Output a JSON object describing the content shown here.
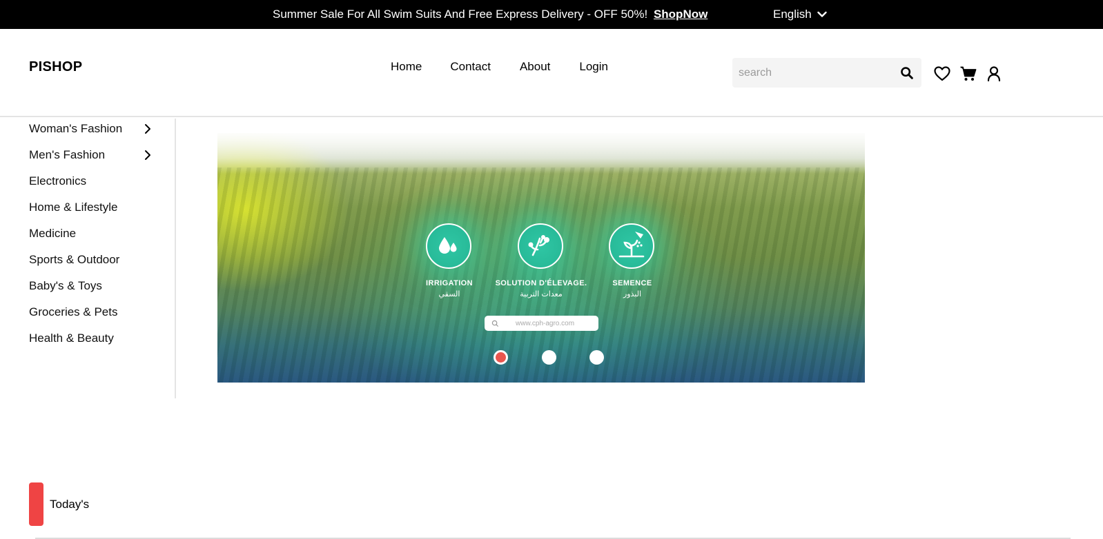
{
  "topbar": {
    "promo_text": "Summer Sale For All Swim Suits And Free Express Delivery - OFF 50%!",
    "promo_link": "ShopNow",
    "language": "English"
  },
  "header": {
    "logo": "PISHOP",
    "nav": [
      "Home",
      "Contact",
      "About",
      "Login"
    ],
    "search_placeholder": "search",
    "icons": [
      "search-icon",
      "heart-icon",
      "cart-icon",
      "user-icon"
    ]
  },
  "sidebar": {
    "items": [
      {
        "label": "Woman's Fashion",
        "has_submenu": true
      },
      {
        "label": "Men's Fashion",
        "has_submenu": true
      },
      {
        "label": "Electronics",
        "has_submenu": false
      },
      {
        "label": "Home & Lifestyle",
        "has_submenu": false
      },
      {
        "label": "Medicine",
        "has_submenu": false
      },
      {
        "label": "Sports & Outdoor",
        "has_submenu": false
      },
      {
        "label": "Baby's & Toys",
        "has_submenu": false
      },
      {
        "label": "Groceries & Pets",
        "has_submenu": false
      },
      {
        "label": "Health & Beauty",
        "has_submenu": false
      }
    ]
  },
  "banner": {
    "features": [
      {
        "title": "IRRIGATION",
        "subtitle": "السقي",
        "icon": "water-drops-icon"
      },
      {
        "title": "SOLUTION D'ÉLEVAGE.",
        "subtitle": "معدات التربية",
        "icon": "livestock-icon"
      },
      {
        "title": "SEMENCE",
        "subtitle": "البذور",
        "icon": "seed-icon"
      }
    ],
    "url": "www.cph-agro.com",
    "slides": 3,
    "active_slide": 1
  },
  "section": {
    "today_label": "Today's"
  },
  "colors": {
    "accent": "#ef4444",
    "topbar_bg": "#000000",
    "badge_teal": "#2fc6a4"
  }
}
